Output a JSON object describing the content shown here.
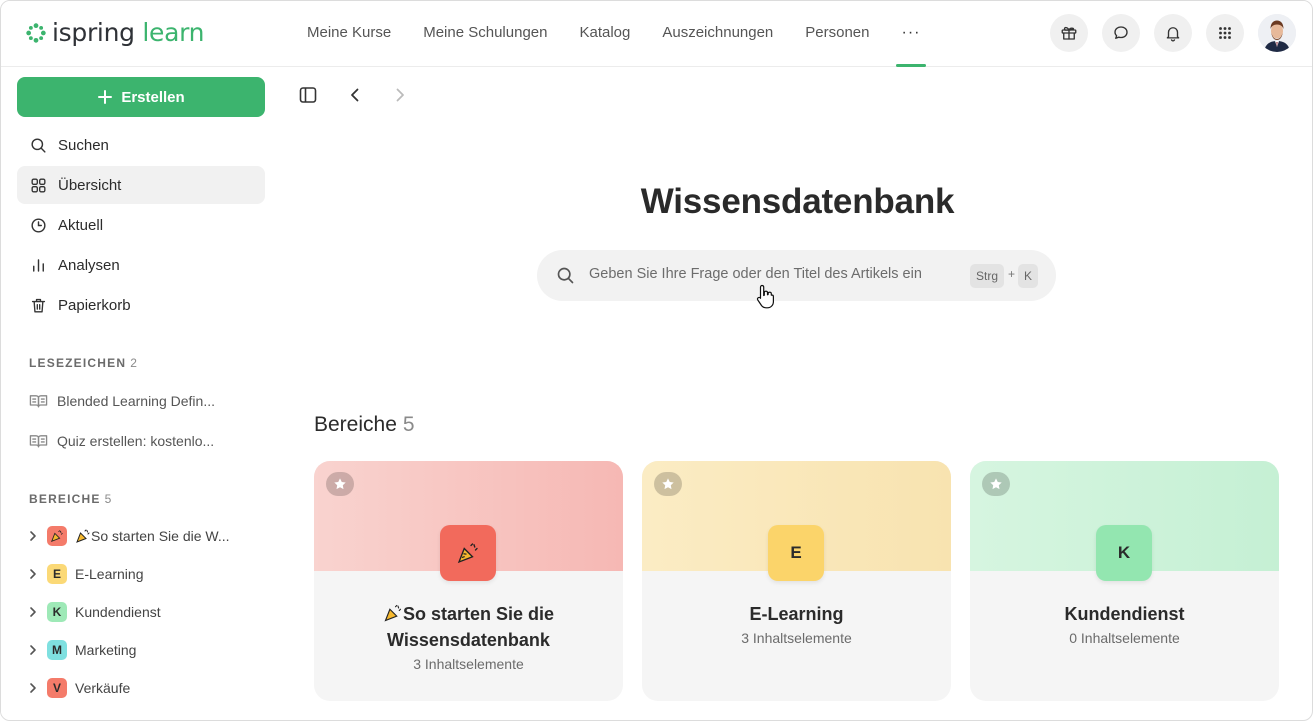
{
  "brand": {
    "name_part1": "ispring",
    "name_part2": "learn",
    "accent": "#3cb46e"
  },
  "nav": {
    "items": [
      {
        "label": "Meine Kurse"
      },
      {
        "label": "Meine Schulungen"
      },
      {
        "label": "Katalog"
      },
      {
        "label": "Auszeichnungen"
      },
      {
        "label": "Personen"
      },
      {
        "label": "···"
      }
    ]
  },
  "sidebar": {
    "create_label": "Erstellen",
    "menu": [
      {
        "label": "Suchen",
        "icon": "search-icon"
      },
      {
        "label": "Übersicht",
        "icon": "grid-icon",
        "active": true
      },
      {
        "label": "Aktuell",
        "icon": "clock-icon"
      },
      {
        "label": "Analysen",
        "icon": "bar-chart-icon"
      },
      {
        "label": "Papierkorb",
        "icon": "trash-icon"
      }
    ],
    "bookmarks": {
      "title": "LESEZEICHEN",
      "count": "2",
      "items": [
        {
          "label": "Blended Learning Defin..."
        },
        {
          "label": "Quiz erstellen: kostenlo..."
        }
      ]
    },
    "areas": {
      "title": "BEREICHE",
      "count": "5",
      "items": [
        {
          "badge": "",
          "label": "So starten Sie die W...",
          "color": "#f47b6a"
        },
        {
          "badge": "E",
          "label": "E-Learning",
          "color": "#fbd977"
        },
        {
          "badge": "K",
          "label": "Kundendienst",
          "color": "#9ee9b7"
        },
        {
          "badge": "M",
          "label": "Marketing",
          "color": "#7fe0e0"
        },
        {
          "badge": "V",
          "label": "Verkäufe",
          "color": "#f47b6a"
        }
      ]
    }
  },
  "main": {
    "title": "Wissensdatenbank",
    "search": {
      "placeholder": "Geben Sie Ihre Frage oder den Titel des Artikels ein",
      "shortcut_key1": "Strg",
      "shortcut_plus": "+",
      "shortcut_key2": "K"
    },
    "areas_heading": "Bereiche",
    "areas_count": "5",
    "cards": [
      {
        "tile": "",
        "title": "So starten Sie die Wissensdatenbank",
        "subtitle": "3 Inhaltselemente"
      },
      {
        "tile": "E",
        "title": "E-Learning",
        "subtitle": "3 Inhaltselemente"
      },
      {
        "tile": "K",
        "title": "Kundendienst",
        "subtitle": "0 Inhaltselemente"
      }
    ]
  }
}
